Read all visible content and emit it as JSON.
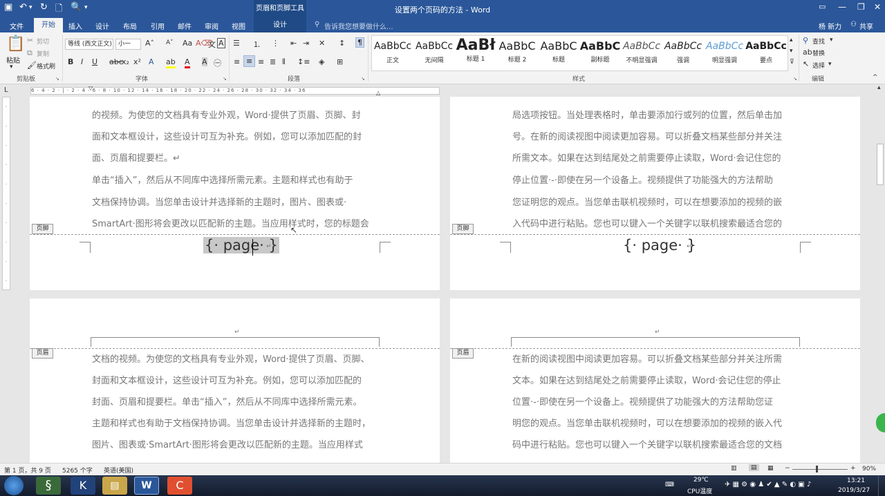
{
  "window": {
    "title": "设置两个页码的方法 - Word",
    "context_group": "页眉和页脚工具",
    "user": "杨 新力",
    "share": "共享"
  },
  "tabs": {
    "file": "文件",
    "home": "开始",
    "insert": "插入",
    "design": "设计",
    "layout": "布局",
    "references": "引用",
    "mailings": "邮件",
    "review": "审阅",
    "view": "视图",
    "hf_design": "设计",
    "tell_me": "告诉我您想要做什么..."
  },
  "ribbon": {
    "clipboard": {
      "paste": "粘贴",
      "cut": "剪切",
      "copy": "复制",
      "format_painter": "格式刷",
      "label": "剪贴板"
    },
    "font": {
      "font_name": "等线 (西文正文)",
      "font_size": "小一",
      "label": "字体"
    },
    "paragraph": {
      "label": "段落"
    },
    "styles": {
      "label": "样式",
      "items": [
        {
          "preview": "AaBbCc",
          "name": "正文",
          "bold": false
        },
        {
          "preview": "AaBbCc",
          "name": "无间隔",
          "bold": false
        },
        {
          "preview": "AaBł",
          "name": "标题 1",
          "bold": true
        },
        {
          "preview": "AaBbC",
          "name": "标题 2",
          "bold": false
        },
        {
          "preview": "AaBbC",
          "name": "标题",
          "bold": false
        },
        {
          "preview": "AaBbC",
          "name": "副标题",
          "bold": true
        },
        {
          "preview": "AaBbCc",
          "name": "不明显强调",
          "bold": false
        },
        {
          "preview": "AaBbCc",
          "name": "强调",
          "bold": false
        },
        {
          "preview": "AaBbCc",
          "name": "明显强调",
          "bold": false
        },
        {
          "preview": "AaBbCc",
          "name": "要点",
          "bold": true
        }
      ]
    },
    "editing": {
      "find": "查找",
      "replace": "替换",
      "select": "选择",
      "label": "编辑"
    }
  },
  "ruler": {
    "ticks": "6 · 4 · 2 · | · 2 · 4 · 6 · 8 · 10 · 12 · 14 · 16 · 18 · 20 · 22 · 24 · 26 · 28 · 30 · 32 · 34 · 36"
  },
  "pages": {
    "p1": {
      "body": [
        "的视频。为使您的文档具有专业外观，Word·提供了页眉、页脚、封",
        "面和文本框设计，这些设计可互为补充。例如，您可以添加匹配的封",
        "面、页眉和提要栏。↵",
        "单击“插入”，然后从不同库中选择所需元素。主题和样式也有助于",
        "文档保持协调。当您单击设计并选择新的主题时，图片、图表或·",
        "SmartArt·图形将会更改以匹配新的主题。当应用样式时，您的标题会"
      ],
      "footer_tag": "页脚",
      "field": "{· page· }"
    },
    "p2": {
      "body": [
        "局选项按钮。当处理表格时，单击要添加行或列的位置，然后单击加",
        "号。在新的阅读视图中阅读更加容易。可以折叠文档某些部分并关注",
        "所需文本。如果在达到结尾处之前需要停止读取，Word·会记住您的",
        "停止位置·-·即使在另一个设备上。视频提供了功能强大的方法帮助",
        "您证明您的观点。当您单击联机视频时，可以在想要添加的视频的嵌",
        "入代码中进行粘贴。您也可以键入一个关键字以联机搜索最适合您的"
      ],
      "footer_tag": "页脚",
      "field": "{· page· }"
    },
    "p3": {
      "header_tag": "页眉",
      "body": [
        "文档的视频。为使您的文档具有专业外观，Word·提供了页眉、页脚、",
        "封面和文本框设计，这些设计可互为补充。例如，您可以添加匹配的",
        "封面、页眉和提要栏。单击“插入”，然后从不同库中选择所需元素。",
        "主题和样式也有助于文档保持协调。当您单击设计并选择新的主题时，",
        "图片、图表或·SmartArt·图形将会更改以匹配新的主题。当应用样式"
      ]
    },
    "p4": {
      "header_tag": "页眉",
      "body": [
        "在新的阅读视图中阅读更加容易。可以折叠文档某些部分并关注所需",
        "文本。如果在达到结尾处之前需要停止读取，Word·会记住您的停止",
        "位置·-·即使在另一个设备上。视频提供了功能强大的方法帮助您证",
        "明您的观点。当您单击联机视频时，可以在想要添加的视频的嵌入代",
        "码中进行粘贴。您也可以键入一个关键字以联机搜索最适合您的文档"
      ]
    }
  },
  "statusbar": {
    "page": "第 1 页，共 9 页",
    "words": "5265 个字",
    "lang": "英语(美国)",
    "zoom": "90%"
  },
  "taskbar": {
    "temp": "29℃",
    "cpu": "CPU温度",
    "time": "13:21",
    "date": "2019/3/27"
  },
  "colors": {
    "accent": "#2b579a",
    "accent_dark": "#1f4a86",
    "ribbon_bg": "#f3f3f3",
    "canvas": "#e6e6e6"
  }
}
